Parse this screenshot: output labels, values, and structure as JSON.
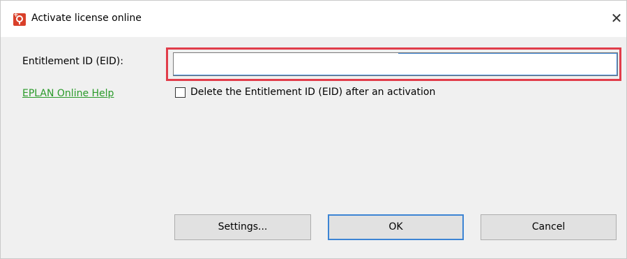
{
  "window": {
    "title": "Activate license online",
    "close_symbol": "✕"
  },
  "form": {
    "eid_label": "Entitlement ID (EID):",
    "eid_value": "",
    "help_link": "EPLAN Online Help",
    "delete_checkbox_label": "Delete the Entitlement ID (EID) after an activation",
    "delete_checkbox_checked": false
  },
  "buttons": {
    "settings": "Settings...",
    "ok": "OK",
    "cancel": "Cancel"
  },
  "colors": {
    "highlight": "#e13d4a",
    "link": "#2a9a2a",
    "focus": "#3c84d4",
    "app_icon": "#d9402a"
  },
  "icons": {
    "app": "license-icon",
    "close": "close-icon"
  }
}
